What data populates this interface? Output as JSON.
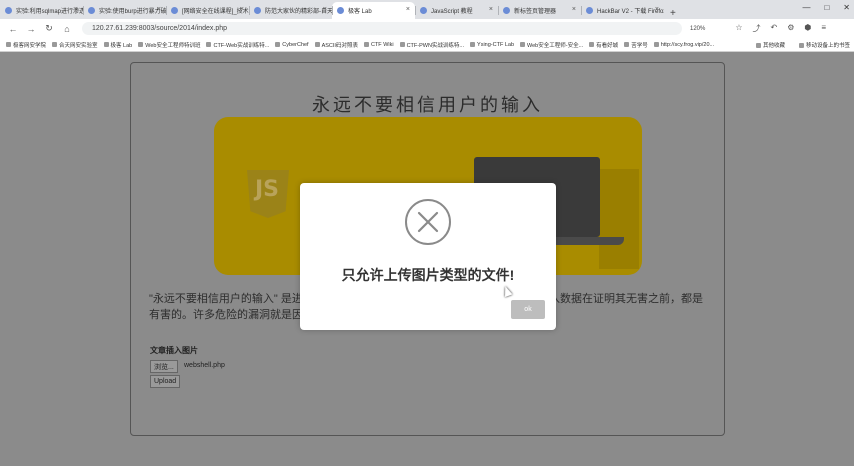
{
  "browser": {
    "tabs": [
      {
        "label": "实验:利用sqlmap进行渗透测"
      },
      {
        "label": "实验:使用burp进行暴力破解"
      },
      {
        "label": "[网络安全在线课程]_技术"
      },
      {
        "label": "防范大家伙的精彩部-自天网"
      },
      {
        "label": "极客 Lab"
      },
      {
        "label": "JavaScript 教程"
      },
      {
        "label": "新标签页管理器"
      },
      {
        "label": "HackBar V2 - 下载 Firefox"
      }
    ],
    "new_tab": "+",
    "url": "120.27.61.239:8003/source/2014/index.php",
    "zoom": "120%",
    "bookmarks": [
      "极客网安学院",
      "合天网安实验室",
      "极客 Lab",
      "Web安全工程师特训班",
      "CTF-Web实战训练特...",
      "CyberChef",
      "ASCII码对照表",
      "CTF Wiki",
      "CTF-PWN实战训练特...",
      "Ysing-CTF Lab",
      "Web安全工程师-安全...",
      "有看好城",
      "苦学号",
      "http://scy.frog.vip/20..."
    ],
    "bookmarks_right": [
      "其他收藏",
      "移动设备上的书签"
    ]
  },
  "page": {
    "headline": "永远不要相信用户的输入",
    "banner_logo": "JS",
    "paragraph_line1_left": "\"永远不要相信用户的输入\" 是进",
    "paragraph_line1_right": "入数据在证明其无害之前，都是",
    "paragraph_line2": "有害的。许多危险的漏洞就是因",
    "upload_label": "文章插入图片",
    "browse_button": "浏览...",
    "selected_file": "webshell.php",
    "upload_button": "Upload"
  },
  "modal": {
    "message": "只允许上传图片类型的文件!",
    "ok_button": "ok",
    "icon": "error-x-icon"
  }
}
